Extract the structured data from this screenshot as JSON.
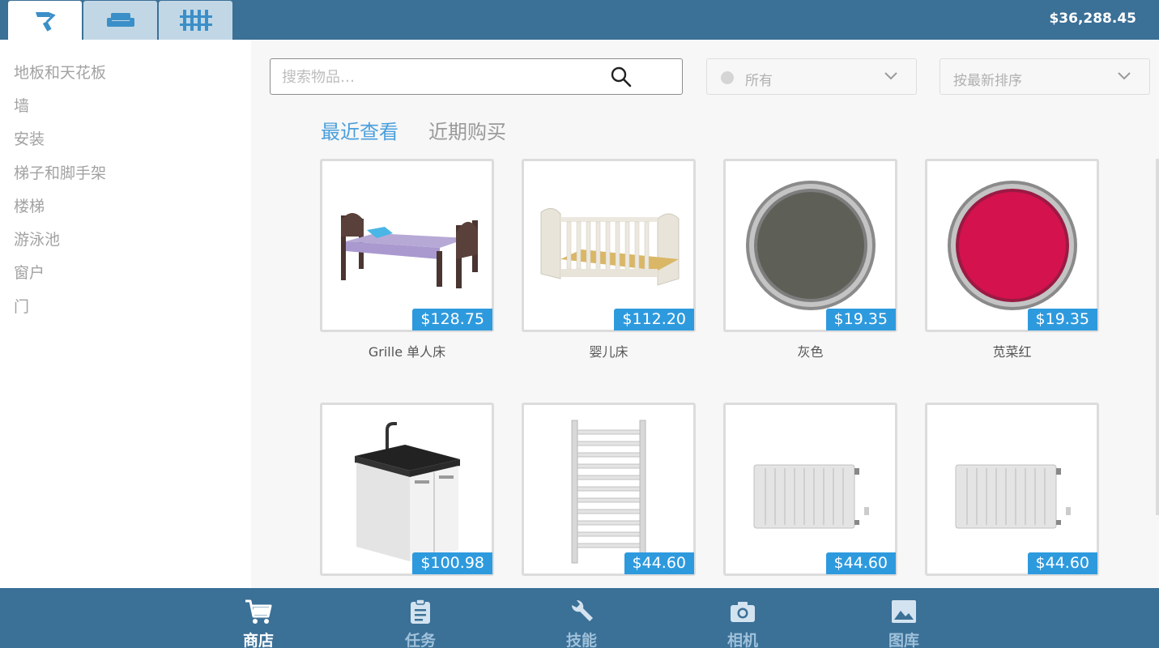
{
  "header": {
    "tabs": [
      {
        "icon": "paint-roller-icon",
        "active": true
      },
      {
        "icon": "sofa-icon",
        "active": false
      },
      {
        "icon": "fence-icon",
        "active": false
      }
    ],
    "balance": "$36,288.45"
  },
  "sidebar": {
    "categories": [
      "地板和天花板",
      "墙",
      "安装",
      "梯子和脚手架",
      "楼梯",
      "游泳池",
      "窗户",
      "门"
    ]
  },
  "search": {
    "placeholder": "搜索物品…"
  },
  "filters": {
    "type_dropdown": "所有",
    "sort_dropdown": "按最新排序"
  },
  "subtabs": {
    "recent_viewed": "最近查看",
    "recent_purchased": "近期购买"
  },
  "items": [
    {
      "name": "Grille 单人床",
      "price": "$128.75",
      "icon": "single-bed-icon"
    },
    {
      "name": "婴儿床",
      "price": "$112.20",
      "icon": "crib-icon"
    },
    {
      "name": "灰色",
      "price": "$19.35",
      "icon": "paint-bucket-icon",
      "color": "#5e6058"
    },
    {
      "name": "苋菜红",
      "price": "$19.35",
      "icon": "paint-bucket-icon",
      "color": "#d4124d"
    },
    {
      "name": "",
      "price": "$100.98",
      "icon": "sink-cabinet-icon"
    },
    {
      "name": "",
      "price": "$44.60",
      "icon": "towel-radiator-icon"
    },
    {
      "name": "",
      "price": "$44.60",
      "icon": "radiator-icon"
    },
    {
      "name": "",
      "price": "$44.60",
      "icon": "radiator-icon"
    }
  ],
  "bottom_nav": [
    {
      "label": "商店",
      "icon": "cart-icon",
      "active": true
    },
    {
      "label": "任务",
      "icon": "clipboard-icon",
      "active": false
    },
    {
      "label": "技能",
      "icon": "wrench-icon",
      "active": false
    },
    {
      "label": "相机",
      "icon": "camera-icon",
      "active": false
    },
    {
      "label": "图库",
      "icon": "image-icon",
      "active": false
    }
  ],
  "colors": {
    "bar": "#3b7097",
    "accent": "#2e9ade",
    "tab_inactive": "#c2d7e6"
  }
}
